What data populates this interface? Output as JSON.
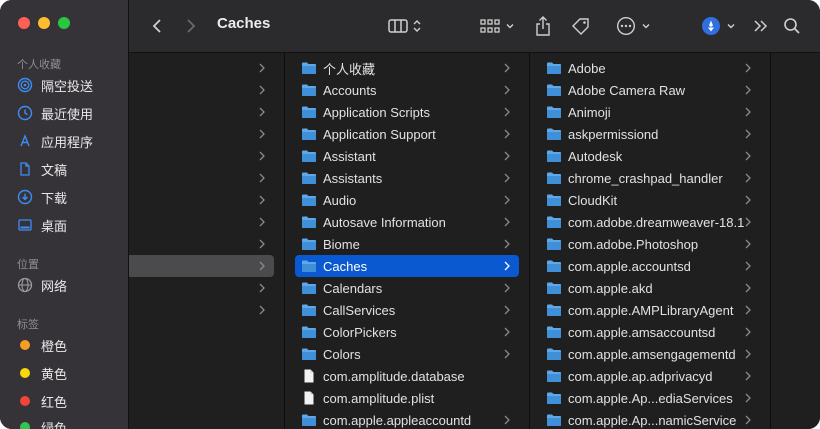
{
  "toolbar": {
    "title": "Caches"
  },
  "sidebar": {
    "favorites_title": "个人收藏",
    "favorites": [
      {
        "label": "隔空投送",
        "icon": "airdrop-icon"
      },
      {
        "label": "最近使用",
        "icon": "clock-icon"
      },
      {
        "label": "应用程序",
        "icon": "applications-icon"
      },
      {
        "label": "文稿",
        "icon": "document-icon"
      },
      {
        "label": "下载",
        "icon": "download-icon"
      },
      {
        "label": "桌面",
        "icon": "desktop-icon"
      }
    ],
    "locations_title": "位置",
    "locations": [
      {
        "label": "网络",
        "icon": "network-icon"
      }
    ],
    "tags_title": "标签",
    "tags": [
      {
        "label": "橙色",
        "color": "#f59e27"
      },
      {
        "label": "黄色",
        "color": "#f5d90a"
      },
      {
        "label": "红色",
        "color": "#f0453b"
      },
      {
        "label": "绿色",
        "color": "#2fc553"
      }
    ]
  },
  "columns": {
    "col2": [
      {
        "label": "个人收藏",
        "type": "folder"
      },
      {
        "label": "Accounts",
        "type": "folder"
      },
      {
        "label": "Application Scripts",
        "type": "folder"
      },
      {
        "label": "Application Support",
        "type": "folder"
      },
      {
        "label": "Assistant",
        "type": "folder"
      },
      {
        "label": "Assistants",
        "type": "folder"
      },
      {
        "label": "Audio",
        "type": "folder"
      },
      {
        "label": "Autosave Information",
        "type": "folder"
      },
      {
        "label": "Biome",
        "type": "folder"
      },
      {
        "label": "Caches",
        "type": "folder",
        "selected": true
      },
      {
        "label": "Calendars",
        "type": "folder"
      },
      {
        "label": "CallServices",
        "type": "folder"
      },
      {
        "label": "ColorPickers",
        "type": "folder"
      },
      {
        "label": "Colors",
        "type": "folder"
      },
      {
        "label": "com.amplitude.database",
        "type": "file"
      },
      {
        "label": "com.amplitude.plist",
        "type": "file"
      },
      {
        "label": "com.apple.appleaccountd",
        "type": "folder"
      }
    ],
    "col3": [
      {
        "label": "Adobe",
        "type": "folder"
      },
      {
        "label": "Adobe Camera Raw",
        "type": "folder"
      },
      {
        "label": "Animoji",
        "type": "folder"
      },
      {
        "label": "askpermissiond",
        "type": "folder"
      },
      {
        "label": "Autodesk",
        "type": "folder"
      },
      {
        "label": "chrome_crashpad_handler",
        "type": "folder"
      },
      {
        "label": "CloudKit",
        "type": "folder"
      },
      {
        "label": "com.adobe.dreamweaver-18.1",
        "type": "folder"
      },
      {
        "label": "com.adobe.Photoshop",
        "type": "folder"
      },
      {
        "label": "com.apple.accountsd",
        "type": "folder"
      },
      {
        "label": "com.apple.akd",
        "type": "folder"
      },
      {
        "label": "com.apple.AMPLibraryAgent",
        "type": "folder"
      },
      {
        "label": "com.apple.amsaccountsd",
        "type": "folder"
      },
      {
        "label": "com.apple.amsengagementd",
        "type": "folder"
      },
      {
        "label": "com.apple.ap.adprivacyd",
        "type": "folder"
      },
      {
        "label": "com.apple.Ap...ediaServices",
        "type": "folder"
      },
      {
        "label": "com.apple.Ap...namicService",
        "type": "folder"
      }
    ]
  }
}
